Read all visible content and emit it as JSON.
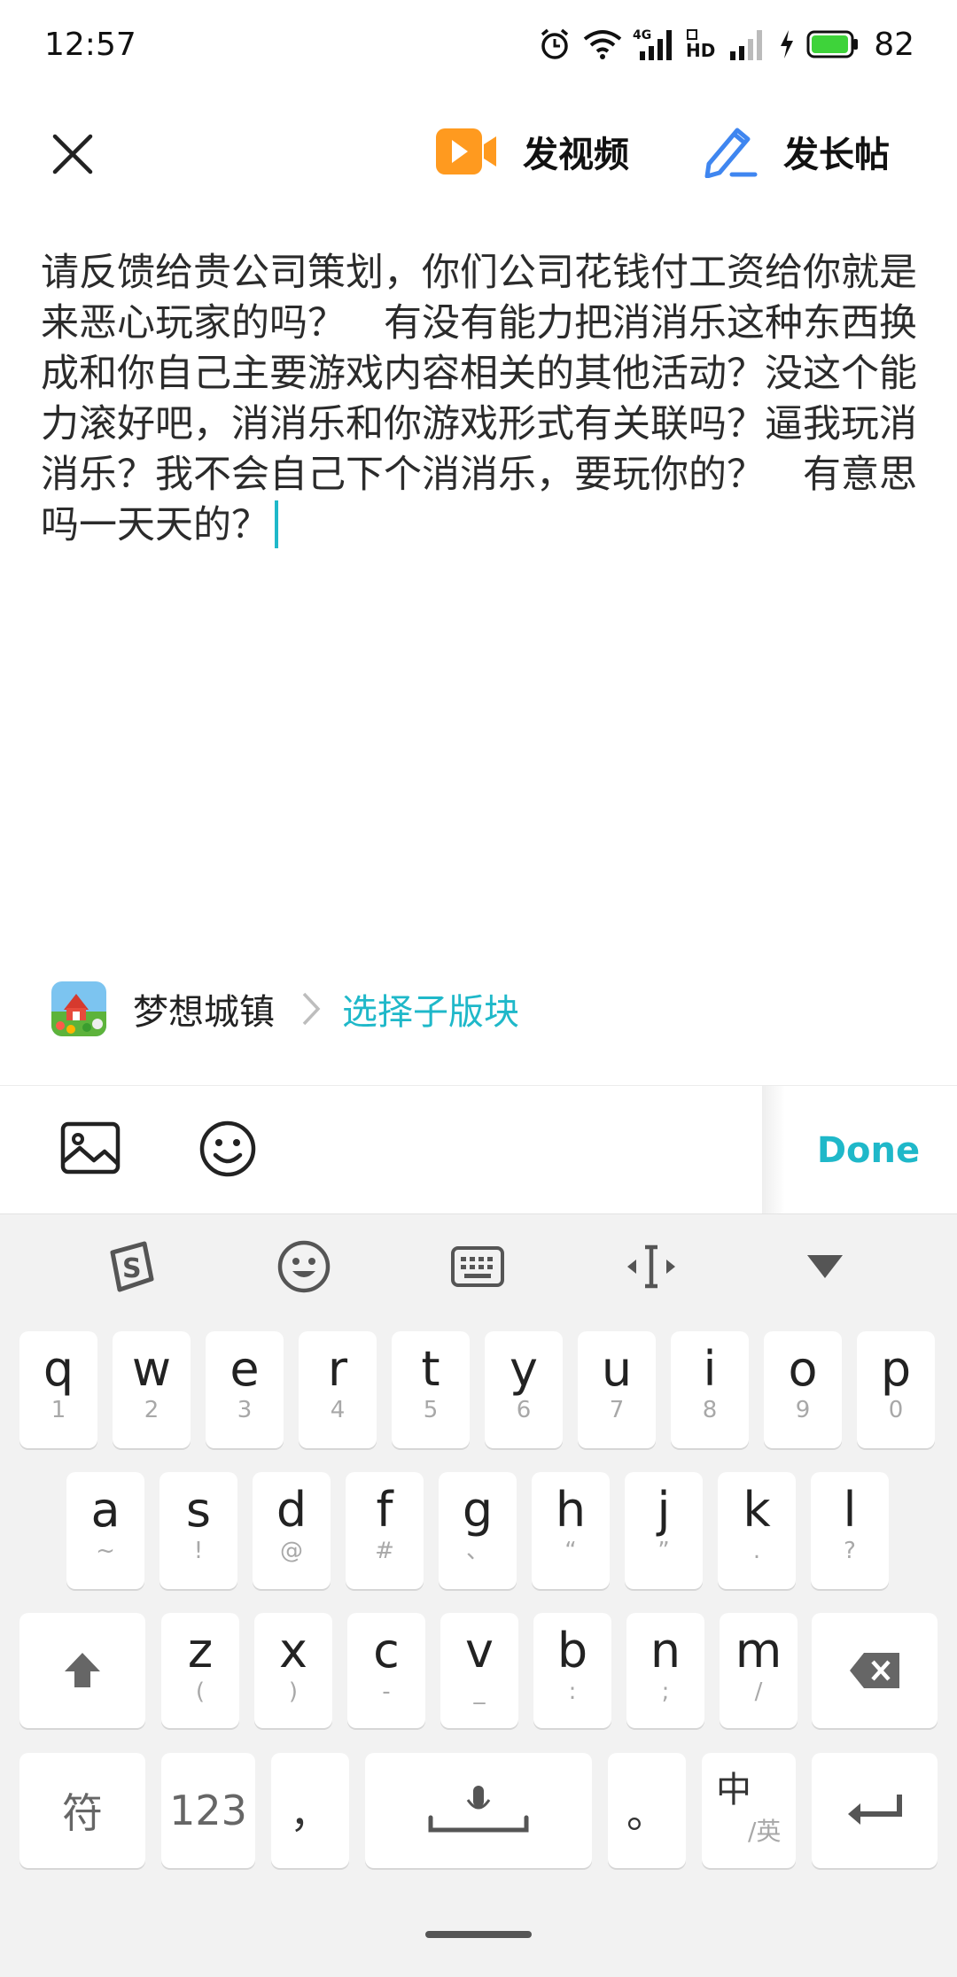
{
  "status_bar": {
    "time": "12:57",
    "network_label": "4G",
    "hd_label": "HD",
    "battery": "82"
  },
  "header": {
    "video_label": "发视频",
    "longpost_label": "发长帖"
  },
  "post": {
    "text": "请反馈给贵公司策划，你们公司花钱付工资给你就是来恶心玩家的吗？　有没有能力把消消乐这种东西换成和你自己主要游戏内容相关的其他活动？没这个能力滚好吧，消消乐和你游戏形式有关联吗？逼我玩消消乐？我不会自己下个消消乐，要玩你的？　有意思吗一天天的？"
  },
  "board": {
    "name": "梦想城镇",
    "sub_label": "选择子版块"
  },
  "editor_toolbar": {
    "done_label": "Done"
  },
  "keyboard": {
    "row1": [
      {
        "k": "q",
        "s": "1"
      },
      {
        "k": "w",
        "s": "2"
      },
      {
        "k": "e",
        "s": "3"
      },
      {
        "k": "r",
        "s": "4"
      },
      {
        "k": "t",
        "s": "5"
      },
      {
        "k": "y",
        "s": "6"
      },
      {
        "k": "u",
        "s": "7"
      },
      {
        "k": "i",
        "s": "8"
      },
      {
        "k": "o",
        "s": "9"
      },
      {
        "k": "p",
        "s": "0"
      }
    ],
    "row2": [
      {
        "k": "a",
        "s": "~"
      },
      {
        "k": "s",
        "s": "!"
      },
      {
        "k": "d",
        "s": "@"
      },
      {
        "k": "f",
        "s": "#"
      },
      {
        "k": "g",
        "s": "、"
      },
      {
        "k": "h",
        "s": "“"
      },
      {
        "k": "j",
        "s": "”"
      },
      {
        "k": "k",
        "s": "."
      },
      {
        "k": "l",
        "s": "?"
      }
    ],
    "row3": [
      {
        "k": "z",
        "s": "("
      },
      {
        "k": "x",
        "s": ")"
      },
      {
        "k": "c",
        "s": "-"
      },
      {
        "k": "v",
        "s": "_"
      },
      {
        "k": "b",
        "s": ":"
      },
      {
        "k": "n",
        "s": ";"
      },
      {
        "k": "m",
        "s": "/"
      }
    ],
    "symbols_label": "符",
    "numbers_label": "123",
    "comma_label": "，",
    "period_label": "。",
    "lang_main": "中",
    "lang_sub": "/英"
  }
}
